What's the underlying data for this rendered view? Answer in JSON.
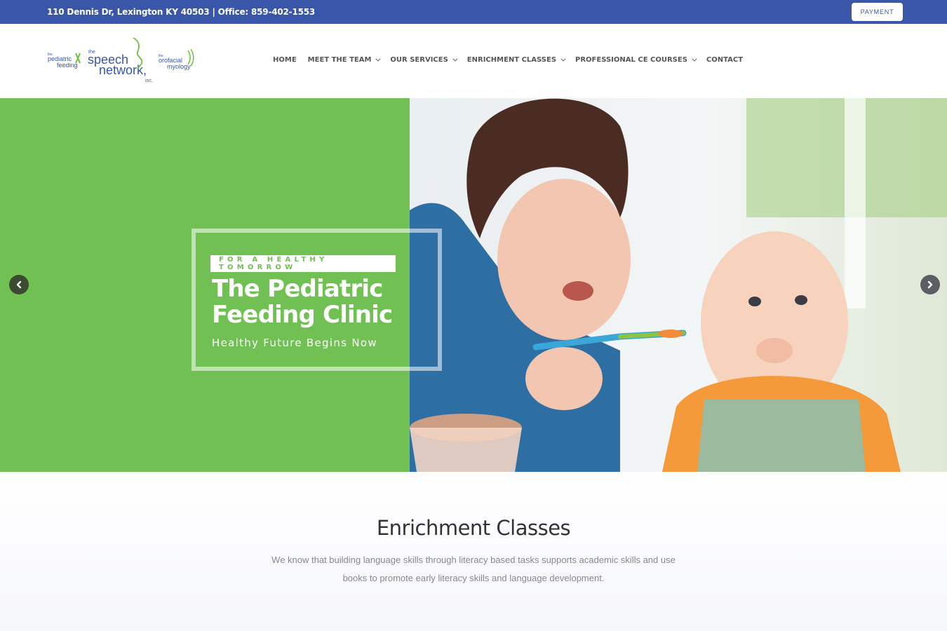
{
  "topbar": {
    "address": "110 Dennis Dr, Lexington KY 40503 | Office: 859-402-1553",
    "payment_label": "PAYMENT"
  },
  "logo": {
    "left_text_small": "the",
    "left_text_1": "pediatric",
    "left_text_2": "feeding",
    "center_small": "the",
    "center_1": "speech",
    "center_2": "network,",
    "center_3": "inc.",
    "right_small": "the",
    "right_1": "orofacial",
    "right_2": "myology"
  },
  "nav": {
    "items": [
      {
        "label": "HOME",
        "dropdown": false
      },
      {
        "label": "MEET THE TEAM",
        "dropdown": true
      },
      {
        "label": "OUR SERVICES",
        "dropdown": true
      },
      {
        "label": "ENRICHMENT CLASSES",
        "dropdown": true
      },
      {
        "label": "PROFESSIONAL CE COURSES",
        "dropdown": true
      },
      {
        "label": "CONTACT",
        "dropdown": false
      }
    ]
  },
  "hero": {
    "tagline": "FOR A HEALTHY TOMORROW",
    "title_line1": "The Pediatric",
    "title_line2": "Feeding Clinic",
    "subtitle": "Healthy Future Begins Now"
  },
  "section": {
    "title": "Enrichment Classes",
    "body_line1": "We know that building language skills through literacy based tasks supports academic skills and use",
    "body_line2": "books to promote early literacy skills and language development."
  },
  "colors": {
    "topbar": "#3a56a8",
    "hero_green": "#71c053",
    "nav_text": "#555555"
  },
  "icons": {
    "prev": "chevron-left-icon",
    "next": "chevron-right-icon"
  }
}
